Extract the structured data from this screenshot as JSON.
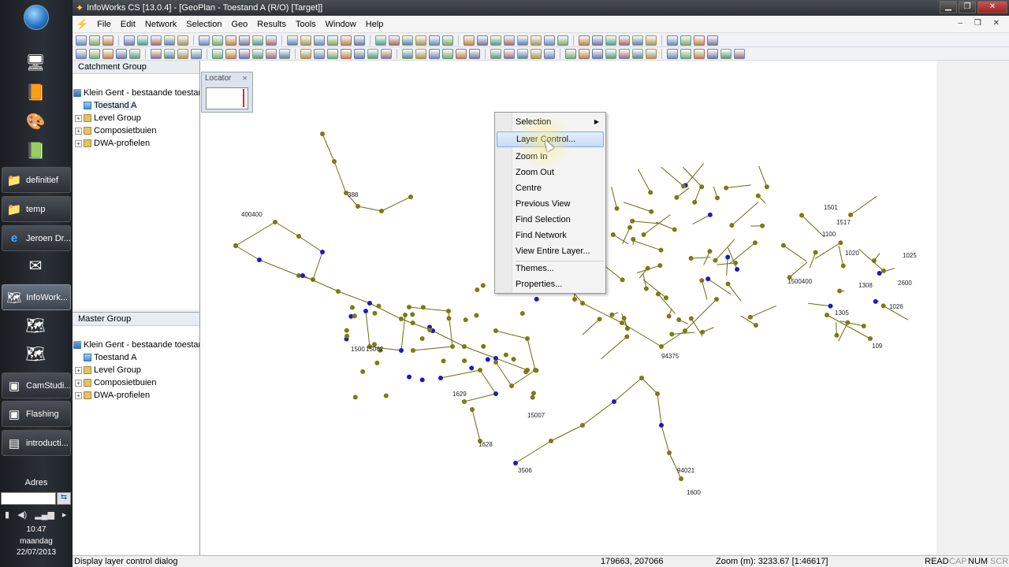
{
  "taskbar": {
    "items": [
      {
        "label": "definitief",
        "icon": "folder-icon"
      },
      {
        "label": "temp",
        "icon": "folder-icon"
      },
      {
        "label": "Jeroen Dr...",
        "icon": "ie-icon"
      },
      {
        "label": "InfoWork...",
        "icon": "infoworks-icon"
      },
      {
        "label": "CamStudi...",
        "icon": "camstudio-icon"
      },
      {
        "label": "Flashing",
        "icon": "window-icon"
      },
      {
        "label": "introducti...",
        "icon": "document-icon"
      }
    ],
    "address_label": "Adres",
    "clock_time": "10:47",
    "clock_day": "maandag",
    "clock_date": "22/07/2013"
  },
  "window": {
    "title": "InfoWorks CS [13.0.4] - [GeoPlan - Toestand A (R/O) [Target]]"
  },
  "menubar": [
    "File",
    "Edit",
    "Network",
    "Selection",
    "Geo",
    "Results",
    "Tools",
    "Window",
    "Help"
  ],
  "catchment_panel": {
    "title": "Catchment Group",
    "tree": [
      {
        "label": "Klein Gent - bestaande toestand",
        "level": 0,
        "icon": "database-icon"
      },
      {
        "label": "Toestand A",
        "level": 1,
        "icon": "network-icon",
        "selected": true
      },
      {
        "label": "Level Group",
        "level": 1,
        "icon": "group-icon",
        "expandable": true
      },
      {
        "label": "Composietbuien",
        "level": 1,
        "icon": "group-icon",
        "expandable": true
      },
      {
        "label": "DWA-profielen",
        "level": 1,
        "icon": "group-icon",
        "expandable": true
      }
    ]
  },
  "master_panel": {
    "title": "Master Group",
    "tree": [
      {
        "label": "Klein Gent - bestaande toestand",
        "level": 0,
        "icon": "database-icon"
      },
      {
        "label": "Toestand A",
        "level": 1,
        "icon": "network-icon"
      },
      {
        "label": "Level Group",
        "level": 1,
        "icon": "group-icon",
        "expandable": true
      },
      {
        "label": "Composietbuien",
        "level": 1,
        "icon": "group-icon",
        "expandable": true
      },
      {
        "label": "DWA-profielen",
        "level": 1,
        "icon": "group-icon",
        "expandable": true
      }
    ]
  },
  "locator": {
    "title": "Locator"
  },
  "context_menu": {
    "items": [
      {
        "label": "Selection",
        "submenu": true
      },
      {
        "label": "Layer Control...",
        "highlighted": true
      },
      {
        "label": "Zoom In"
      },
      {
        "label": "Zoom Out"
      },
      {
        "label": "Centre"
      },
      {
        "label": "Previous View"
      },
      {
        "label": "Find Selection"
      },
      {
        "label": "Find Network"
      },
      {
        "label": "View Entire Layer..."
      },
      {
        "label": "Themes..."
      },
      {
        "label": "Properties..."
      }
    ]
  },
  "map_labels": [
    "1628",
    "3506",
    "1600",
    "109",
    "1500",
    "15062",
    "388",
    "1300",
    "400400",
    "1020",
    "1517",
    "1025",
    "1026",
    "1100",
    "1500400",
    "1501",
    "2600",
    "1308",
    "1305",
    "15007",
    "1629",
    "94375",
    "94021"
  ],
  "statusbar": {
    "message": "Display layer control dialog",
    "coords": "179663, 207066",
    "zoom": "Zoom (m): 3233.67 [1:46617]",
    "read": "READ",
    "cap": "CAP",
    "num": "NUM",
    "scrl": "SCRL"
  },
  "colors": {
    "node_olive": "#7d7a12",
    "node_blue": "#1a1ac8",
    "link": "#6b6a10",
    "menu_highlight": "#c6dcf5"
  }
}
